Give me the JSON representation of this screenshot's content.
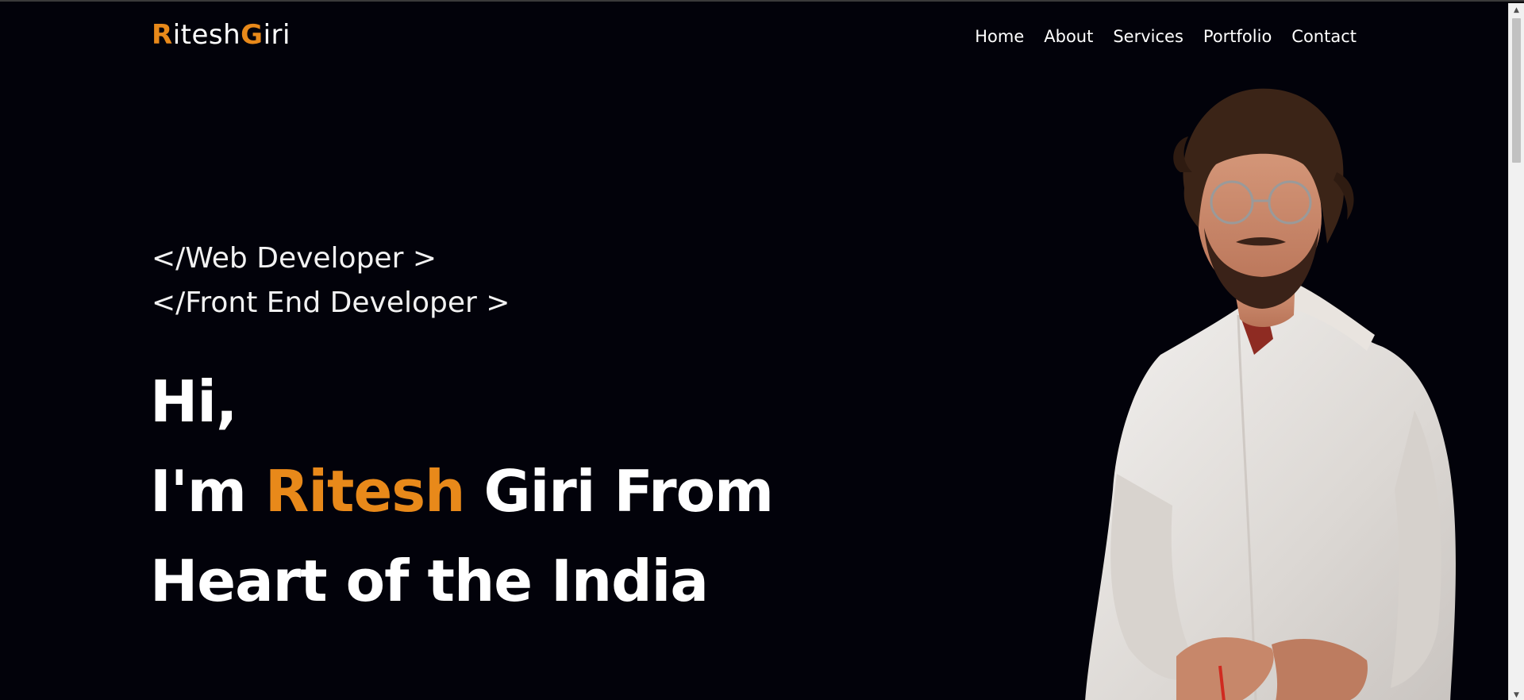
{
  "logo": {
    "r_letter": "R",
    "itesh": "itesh",
    "g_letter": "G",
    "iri": "iri",
    "accent_color": "#e8891a"
  },
  "nav": {
    "items": [
      {
        "label": "Home"
      },
      {
        "label": "About"
      },
      {
        "label": "Services"
      },
      {
        "label": "Portfolio"
      },
      {
        "label": "Contact"
      }
    ]
  },
  "hero": {
    "roles": [
      "</Web Developer >",
      "</Front End Developer >"
    ],
    "greeting": "Hi,",
    "intro_prefix": "I'm ",
    "first_name": "Ritesh",
    "intro_suffix": " Giri From",
    "line3": "Heart of the India"
  },
  "colors": {
    "background": "#02020a",
    "accent": "#e8891a",
    "text": "#ffffff"
  },
  "icons": {
    "photo": "portrait-photo",
    "scroll_up": "scroll-up-arrow-icon",
    "scroll_down": "scroll-down-arrow-icon"
  }
}
